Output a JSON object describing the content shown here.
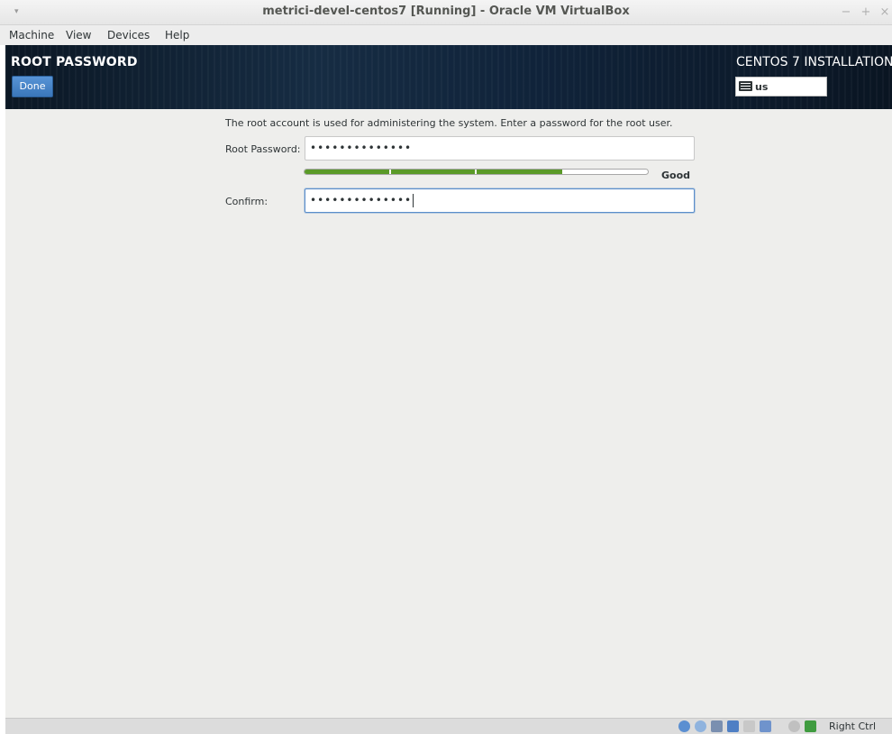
{
  "window": {
    "title": "metrici-devel-centos7 [Running] - Oracle VM VirtualBox",
    "menu_icon": "chevron-down-icon",
    "controls": [
      "−",
      "+",
      "×"
    ]
  },
  "menubar": {
    "items": [
      "Machine",
      "View",
      "Devices",
      "Help"
    ]
  },
  "installer": {
    "spoke_title": "ROOT PASSWORD",
    "done_label": "Done",
    "product_title": "CENTOS 7 INSTALLATION",
    "keyboard_layout": "us",
    "intro_text": "The root account is used for administering the system.  Enter a password for the root user.",
    "root_password_label": "Root Password:",
    "root_password_value": "••••••••••••••",
    "strength_fraction": 0.75,
    "strength_label": "Good",
    "confirm_label": "Confirm:",
    "confirm_value": "••••••••••••••",
    "colors": {
      "header_bg": "#0d1a27",
      "done_button": "#4a86c8",
      "strength_bar": "#5a9a28",
      "focus_border": "#5b8ecb"
    }
  },
  "statusbar": {
    "icons": [
      "hard-disk-icon",
      "optical-disk-icon",
      "usb-icon",
      "network-icon",
      "shared-folders-icon",
      "display-icon",
      "mouse-integration-icon",
      "capture-icon"
    ],
    "host_key": "Right Ctrl"
  }
}
